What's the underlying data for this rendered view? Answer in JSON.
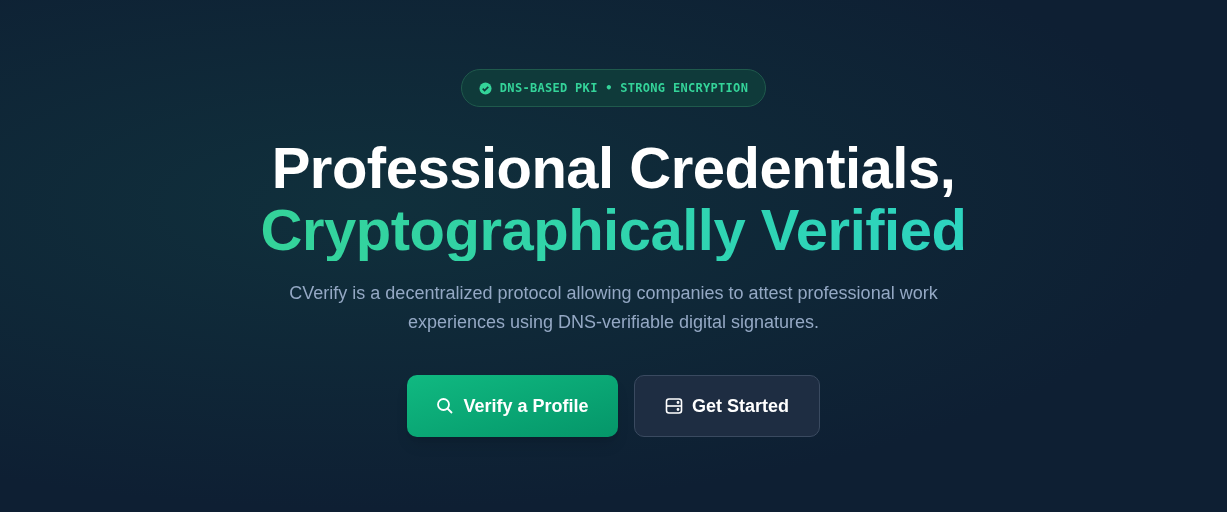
{
  "badge": "DNS-BASED PKI • STRONG ENCRYPTION",
  "headline": [
    "Professional Credentials,",
    "Cryptographically Verified"
  ],
  "description": "CVerify is a decentralized protocol allowing companies to attest professional work experiences using DNS-verifiable digital signatures.",
  "buttons": [
    {
      "label": "Verify a Profile",
      "kind": "primary"
    },
    {
      "label": "Get Started",
      "kind": "secondary"
    }
  ]
}
